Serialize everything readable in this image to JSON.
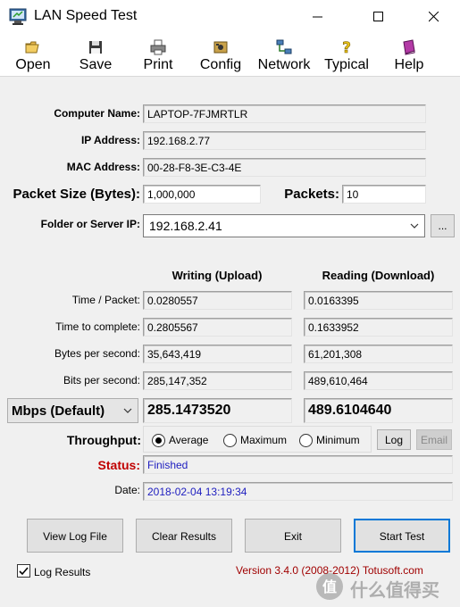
{
  "window": {
    "title": "LAN Speed Test"
  },
  "toolbar": {
    "items": [
      {
        "label": "Open",
        "icon": "folder-open-icon"
      },
      {
        "label": "Save",
        "icon": "floppy-disk-icon"
      },
      {
        "label": "Print",
        "icon": "printer-icon"
      },
      {
        "label": "Config",
        "icon": "config-icon"
      },
      {
        "label": "Network",
        "icon": "network-icon"
      },
      {
        "label": "Typical",
        "icon": "help-question-icon"
      },
      {
        "label": "Help",
        "icon": "help-book-icon"
      }
    ]
  },
  "info": {
    "computer_name_label": "Computer Name:",
    "computer_name": "LAPTOP-7FJMRTLR",
    "ip_label": "IP Address:",
    "ip": "192.168.2.77",
    "mac_label": "MAC Address:",
    "mac": "00-28-F8-3E-C3-4E",
    "packet_size_label": "Packet Size (Bytes):",
    "packet_size": "1,000,000",
    "packets_label": "Packets:",
    "packets": "10",
    "folder_label": "Folder or Server IP:",
    "folder_value": "192.168.2.41",
    "browse_label": "..."
  },
  "results": {
    "col_write": "Writing (Upload)",
    "col_read": "Reading (Download)",
    "rows": [
      {
        "label": "Time / Packet:",
        "write": "0.0280557",
        "read": "0.0163395"
      },
      {
        "label": "Time to complete:",
        "write": "0.2805567",
        "read": "0.1633952"
      },
      {
        "label": "Bytes per second:",
        "write": "35,643,419",
        "read": "61,201,308"
      },
      {
        "label": "Bits per second:",
        "write": "285,147,352",
        "read": "489,610,464"
      }
    ],
    "unit": "Mbps (Default)",
    "write_big": "285.1473520",
    "read_big": "489.6104640"
  },
  "throughput": {
    "label": "Throughput:",
    "options": [
      "Average",
      "Maximum",
      "Minimum"
    ],
    "selected": "Average",
    "log_label": "Log",
    "email_label": "Email"
  },
  "status": {
    "label": "Status:",
    "value": "Finished",
    "date_label": "Date:",
    "date": "2018-02-04 13:19:34"
  },
  "buttons": {
    "view_log": "View Log File",
    "clear": "Clear Results",
    "exit": "Exit",
    "start": "Start Test"
  },
  "footer": {
    "log_results_label": "Log Results",
    "log_results_checked": true,
    "version": "Version 3.4.0  (2008-2012) Totusoft.com",
    "watermark": "什么值得买"
  },
  "colors": {
    "status_label": "#c00000",
    "version": "#a00000",
    "status_value": "#2020c0",
    "accent": "#0078d7"
  }
}
